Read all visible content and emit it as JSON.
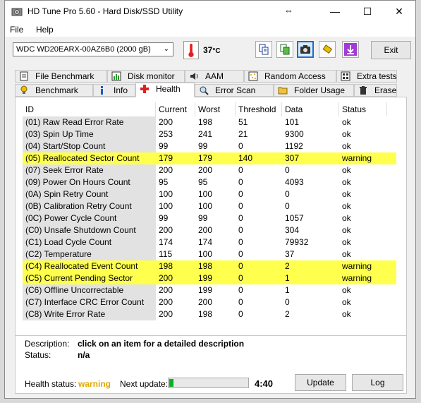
{
  "window": {
    "title": "HD Tune Pro 5.60 - Hard Disk/SSD Utility",
    "move_glyph": "⇔",
    "minimize": "—",
    "maximize": "☐",
    "close": "✕"
  },
  "menu": {
    "file": "File",
    "help": "Help"
  },
  "toolbar": {
    "drive": "WDC WD20EARX-00AZ6B0 (2000 gB)",
    "temperature": "37",
    "temperature_unit": "°C",
    "exit_label": "Exit",
    "icons": [
      "copy-icon",
      "copy-green-icon",
      "camera-icon",
      "usb-stick-icon",
      "download-icon"
    ]
  },
  "tabs": {
    "top": [
      {
        "label": "File Benchmark",
        "icon": "file-benchmark-icon"
      },
      {
        "label": "Disk monitor",
        "icon": "disk-monitor-icon"
      },
      {
        "label": "AAM",
        "icon": "speaker-icon"
      },
      {
        "label": "Random Access",
        "icon": "random-access-icon"
      },
      {
        "label": "Extra tests",
        "icon": "extra-tests-icon"
      }
    ],
    "bottom": [
      {
        "label": "Benchmark",
        "icon": "lightbulb-icon"
      },
      {
        "label": "Info",
        "icon": "info-icon"
      },
      {
        "label": "Health",
        "icon": "health-cross-icon"
      },
      {
        "label": "Error Scan",
        "icon": "magnifier-icon"
      },
      {
        "label": "Folder Usage",
        "icon": "folder-icon"
      },
      {
        "label": "Erase",
        "icon": "trash-icon"
      }
    ],
    "active": "Health"
  },
  "table": {
    "columns": [
      "ID",
      "Current",
      "Worst",
      "Threshold",
      "Data",
      "Status"
    ],
    "rows": [
      [
        "(01) Raw Read Error Rate",
        "200",
        "198",
        "51",
        "101",
        "ok"
      ],
      [
        "(03) Spin Up Time",
        "253",
        "241",
        "21",
        "9300",
        "ok"
      ],
      [
        "(04) Start/Stop Count",
        "99",
        "99",
        "0",
        "1192",
        "ok"
      ],
      [
        "(05) Reallocated Sector Count",
        "179",
        "179",
        "140",
        "307",
        "warning"
      ],
      [
        "(07) Seek Error Rate",
        "200",
        "200",
        "0",
        "0",
        "ok"
      ],
      [
        "(09) Power On Hours Count",
        "95",
        "95",
        "0",
        "4093",
        "ok"
      ],
      [
        "(0A) Spin Retry Count",
        "100",
        "100",
        "0",
        "0",
        "ok"
      ],
      [
        "(0B) Calibration Retry Count",
        "100",
        "100",
        "0",
        "0",
        "ok"
      ],
      [
        "(0C) Power Cycle Count",
        "99",
        "99",
        "0",
        "1057",
        "ok"
      ],
      [
        "(C0) Unsafe Shutdown Count",
        "200",
        "200",
        "0",
        "304",
        "ok"
      ],
      [
        "(C1) Load Cycle Count",
        "174",
        "174",
        "0",
        "79932",
        "ok"
      ],
      [
        "(C2) Temperature",
        "115",
        "100",
        "0",
        "37",
        "ok"
      ],
      [
        "(C4) Reallocated Event Count",
        "198",
        "198",
        "0",
        "2",
        "warning"
      ],
      [
        "(C5) Current Pending Sector",
        "200",
        "199",
        "0",
        "1",
        "warning"
      ],
      [
        "(C6) Offline Uncorrectable",
        "200",
        "199",
        "0",
        "1",
        "ok"
      ],
      [
        "(C7) Interface CRC Error Count",
        "200",
        "200",
        "0",
        "0",
        "ok"
      ],
      [
        "(C8) Write Error Rate",
        "200",
        "198",
        "0",
        "2",
        "ok"
      ]
    ],
    "warning_color": "#ffff4d"
  },
  "description": {
    "label": "Description:",
    "value": "click on an item for a detailed description",
    "status_label": "Status:",
    "status_value": "n/a"
  },
  "footer": {
    "health_label": "Health status:",
    "health_value": "warning",
    "health_color": "#e0a800",
    "next_update_label": "Next update:",
    "progress": 0.05,
    "time": "4:40",
    "update_label": "Update",
    "log_label": "Log"
  }
}
